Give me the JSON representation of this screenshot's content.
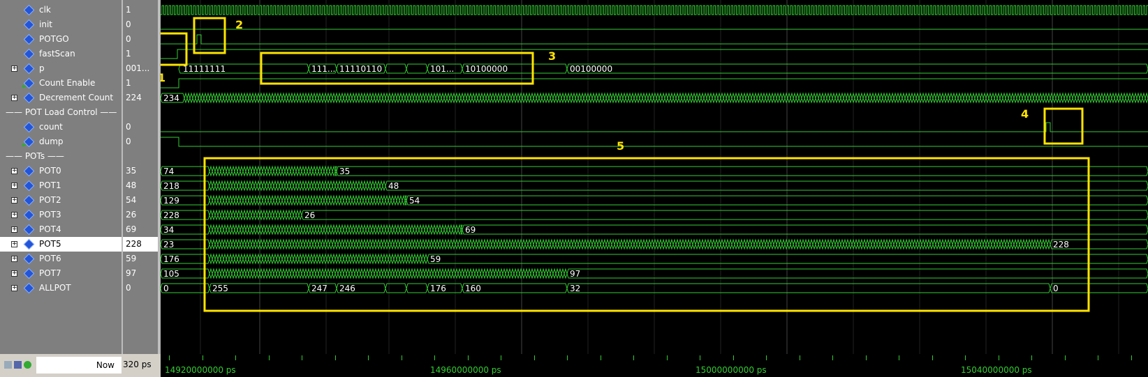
{
  "signals": [
    {
      "name": "clk",
      "value": "1",
      "icon": "diamond",
      "expand": false
    },
    {
      "name": "init",
      "value": "0",
      "icon": "diamond",
      "expand": false
    },
    {
      "name": "POTGO",
      "value": "0",
      "icon": "diamond",
      "expand": false
    },
    {
      "name": "fastScan",
      "value": "1",
      "icon": "diamond",
      "expand": false
    },
    {
      "name": "p",
      "value": "001...",
      "icon": "diamond",
      "expand": true
    },
    {
      "name": "Count Enable",
      "value": "1",
      "icon": "arrow",
      "expand": false
    },
    {
      "name": "Decrement Count",
      "value": "224",
      "icon": "diamond",
      "expand": true
    },
    {
      "group": "POT Load Control"
    },
    {
      "name": "count",
      "value": "0",
      "icon": "diamond",
      "expand": false
    },
    {
      "name": "dump",
      "value": "0",
      "icon": "arrow",
      "expand": false
    },
    {
      "group": "POTs"
    },
    {
      "name": "POT0",
      "value": "35",
      "icon": "diamond",
      "expand": true
    },
    {
      "name": "POT1",
      "value": "48",
      "icon": "diamond",
      "expand": true
    },
    {
      "name": "POT2",
      "value": "54",
      "icon": "diamond",
      "expand": true
    },
    {
      "name": "POT3",
      "value": "26",
      "icon": "diamond",
      "expand": true
    },
    {
      "name": "POT4",
      "value": "69",
      "icon": "diamond",
      "expand": true
    },
    {
      "name": "POT5",
      "value": "228",
      "icon": "diamond",
      "expand": true,
      "selected": true
    },
    {
      "name": "POT6",
      "value": "59",
      "icon": "diamond",
      "expand": true
    },
    {
      "name": "POT7",
      "value": "97",
      "icon": "diamond",
      "expand": true
    },
    {
      "name": "ALLPOT",
      "value": "0",
      "icon": "diamond",
      "expand": true
    }
  ],
  "waves": {
    "p": {
      "labels": [
        "11111111",
        "111...",
        "11110110",
        "101...",
        "10100000",
        "00100000"
      ]
    },
    "decrement": {
      "labels": [
        "234"
      ]
    },
    "pots": [
      {
        "start": "74",
        "end": "35"
      },
      {
        "start": "218",
        "end": "48"
      },
      {
        "start": "129",
        "end": "54"
      },
      {
        "start": "228",
        "end": "26"
      },
      {
        "start": "34",
        "end": "69"
      },
      {
        "start": "23",
        "end": "228"
      },
      {
        "start": "176",
        "end": "59"
      },
      {
        "start": "105",
        "end": "97"
      }
    ],
    "allpot": {
      "labels": [
        "0",
        "255",
        "247",
        "246",
        "176",
        "160",
        "32",
        "0"
      ]
    }
  },
  "now": {
    "label": "Now",
    "value": "320 ps"
  },
  "timeline": {
    "ticks": [
      "14920000000 ps",
      "14960000000 ps",
      "15000000000 ps",
      "15040000000 ps"
    ]
  },
  "annotations": [
    "1",
    "2",
    "3",
    "4",
    "5"
  ],
  "colors": {
    "wave": "#33cc33",
    "highlight": "#ffe400",
    "grid": "#555555",
    "signal_icon": "#2255d8"
  }
}
